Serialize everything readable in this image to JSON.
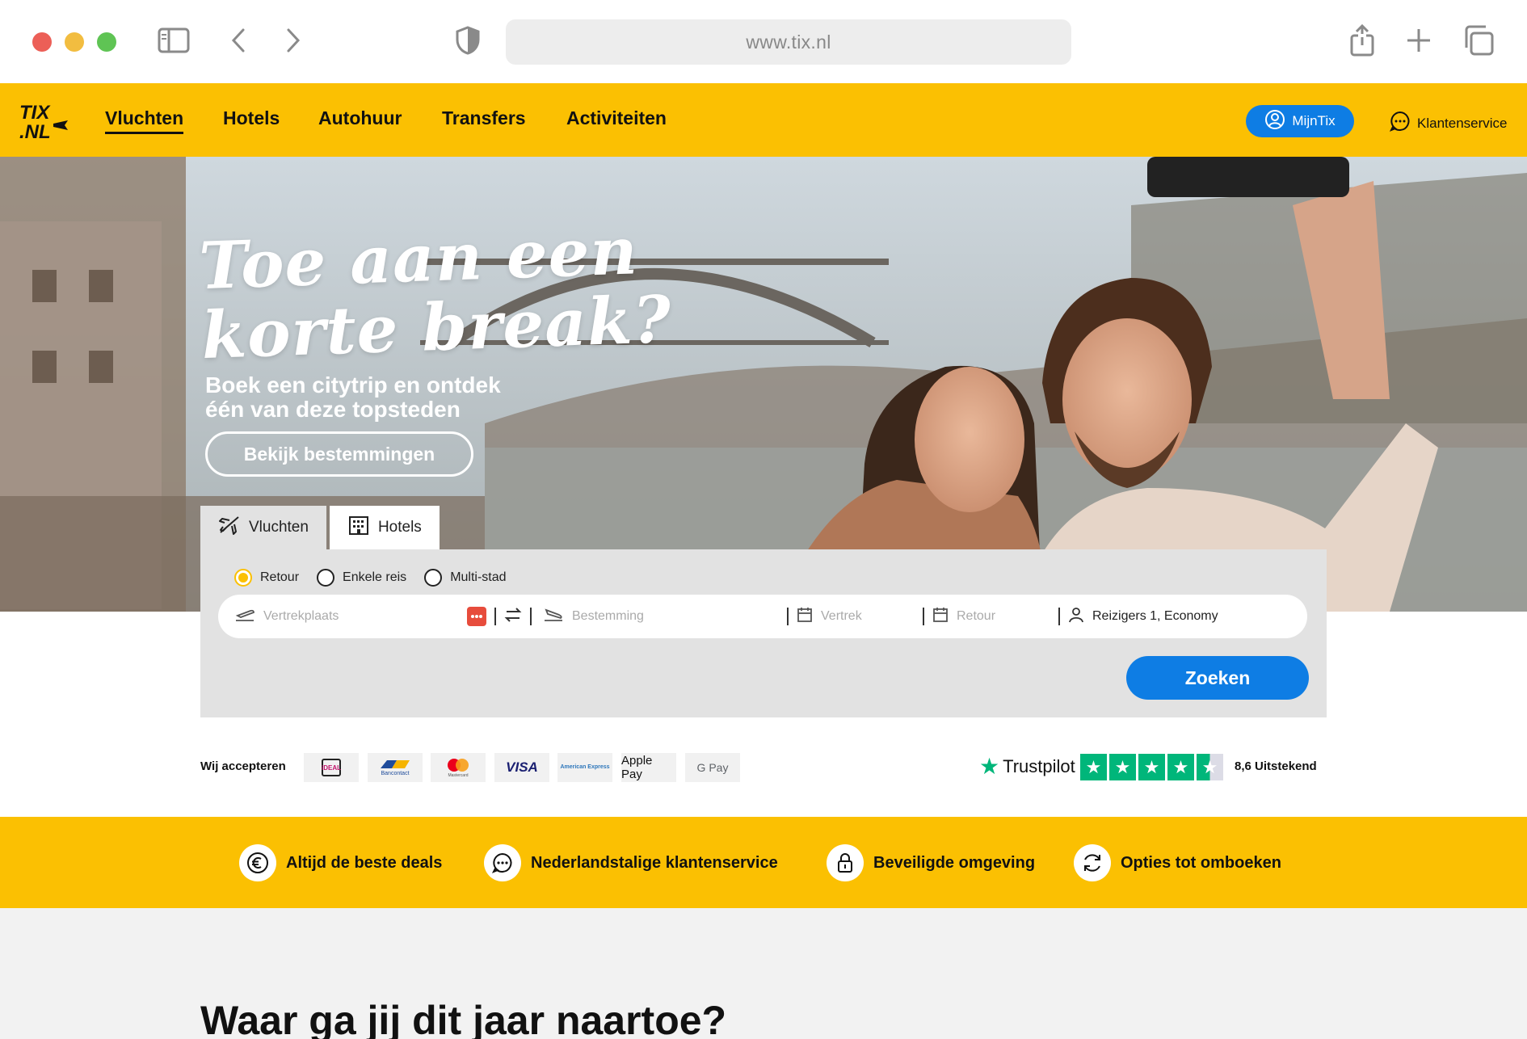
{
  "browser": {
    "url": "www.tix.nl",
    "icons": [
      "sidebar-icon",
      "back-icon",
      "forward-icon",
      "shield-icon",
      "share-icon",
      "new-tab-icon",
      "tabs-icon"
    ]
  },
  "nav": {
    "logo_top": "TIX",
    "logo_bottom": ".NL",
    "links": [
      "Vluchten",
      "Hotels",
      "Autohuur",
      "Transfers",
      "Activiteiten"
    ],
    "active_link": "Vluchten",
    "account_label": "MijnTix",
    "service_label": "Klantenservice",
    "colors": {
      "brand_yellow": "#fbc002",
      "accent_blue": "#0e7de4"
    }
  },
  "hero": {
    "title_line1": "Toe aan een",
    "title_line2": "korte break?",
    "subtitle_line1": "Boek een citytrip en ontdek",
    "subtitle_line2": "één van deze topsteden",
    "cta_label": "Bekijk bestemmingen"
  },
  "search": {
    "tabs": [
      {
        "label": "Vluchten",
        "icon": "plane-icon",
        "active": true
      },
      {
        "label": "Hotels",
        "icon": "building-icon",
        "active": false
      }
    ],
    "trip_types": [
      {
        "label": "Retour",
        "selected": true
      },
      {
        "label": "Enkele reis",
        "selected": false
      },
      {
        "label": "Multi-stad",
        "selected": false
      }
    ],
    "fields": {
      "origin_placeholder": "Vertrekplaats",
      "destination_placeholder": "Bestemming",
      "depart_placeholder": "Vertrek",
      "return_placeholder": "Retour",
      "travellers_value": "Reizigers 1, Economy"
    },
    "submit_label": "Zoeken"
  },
  "payments": {
    "label": "Wij accepteren",
    "methods": [
      "iDEAL",
      "Bancontact",
      "Mastercard",
      "VISA",
      "American Express",
      "Apple Pay",
      "G Pay"
    ]
  },
  "trustpilot": {
    "brand": "Trustpilot",
    "stars": 4.5,
    "score_label": "8,6 Uitstekend"
  },
  "usps": [
    {
      "label": "Altijd de beste deals",
      "icon": "euro-icon"
    },
    {
      "label": "Nederlandstalige klantenservice",
      "icon": "chat-icon"
    },
    {
      "label": "Beveiligde omgeving",
      "icon": "lock-icon"
    },
    {
      "label": "Opties tot omboeken",
      "icon": "refresh-icon"
    }
  ],
  "section": {
    "title": "Waar ga jij dit jaar naartoe?"
  }
}
